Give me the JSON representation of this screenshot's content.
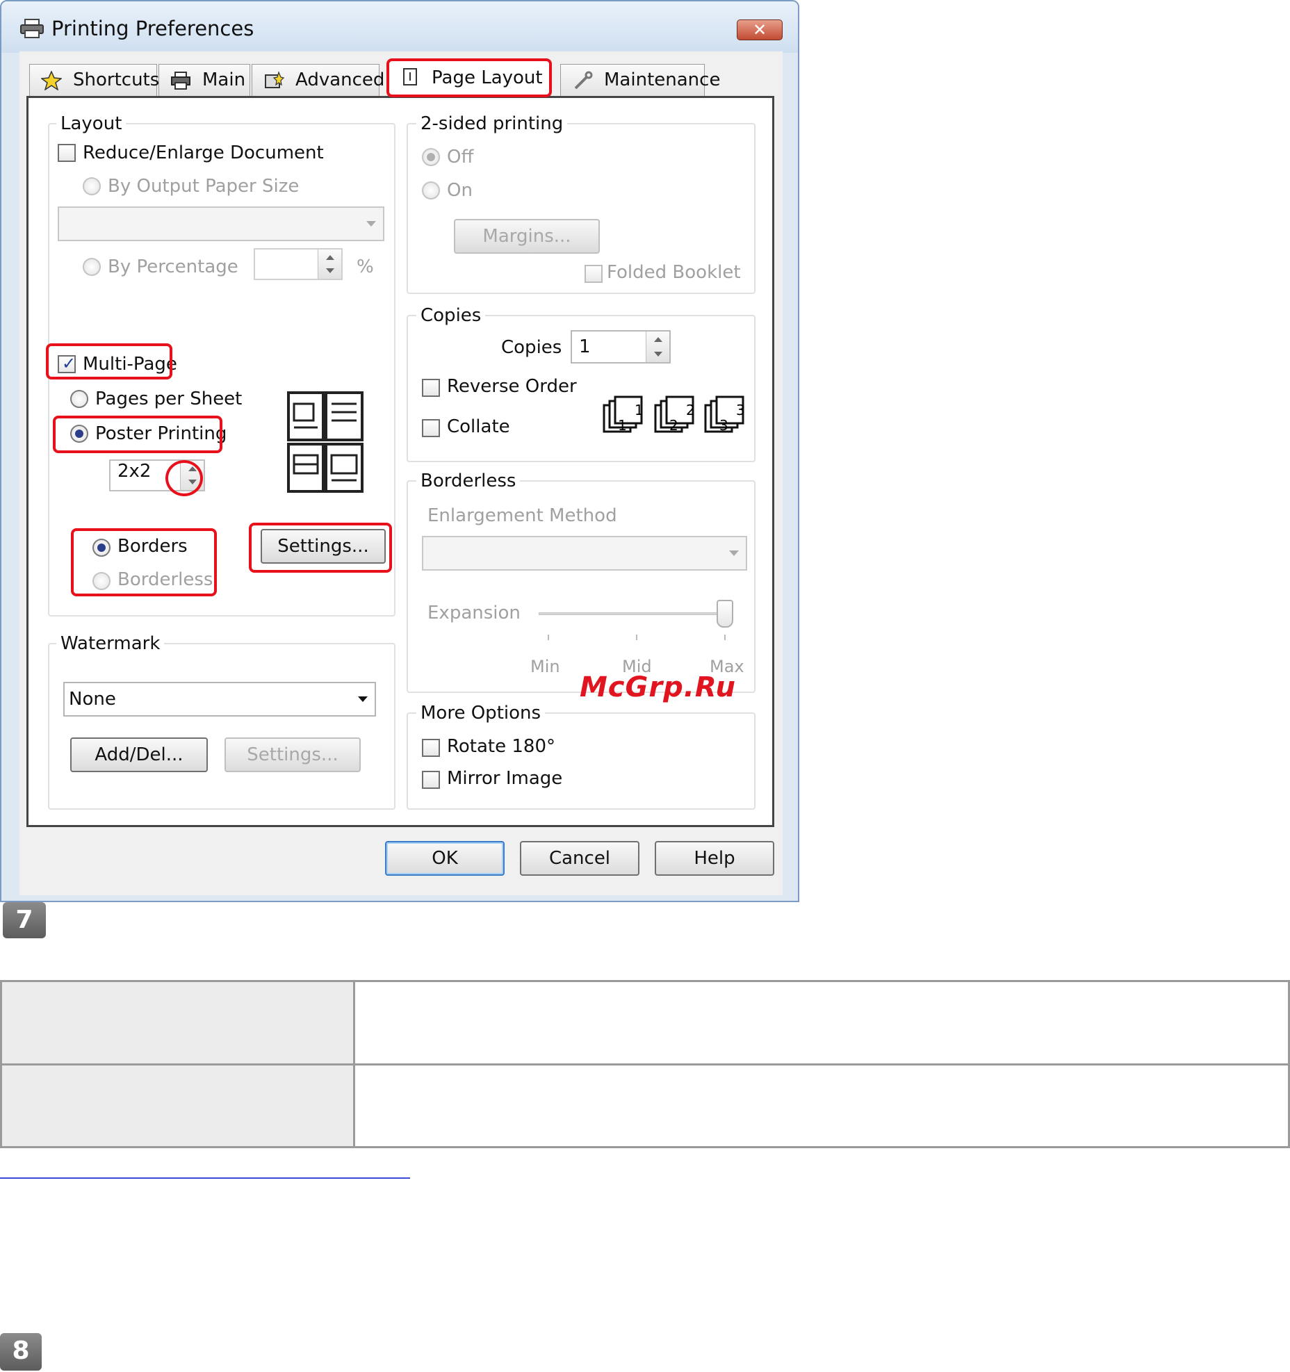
{
  "window": {
    "title": "Printing Preferences",
    "close_label": "✕"
  },
  "tabs": [
    {
      "label": "Shortcuts",
      "icon": "star-icon"
    },
    {
      "label": "Main",
      "icon": "printer-icon"
    },
    {
      "label": "Advanced",
      "icon": "advanced-gear-icon"
    },
    {
      "label": "Page Layout",
      "icon": "page-icon",
      "active": true
    },
    {
      "label": "Maintenance",
      "icon": "wrench-icon"
    }
  ],
  "layout": {
    "group_label": "Layout",
    "reduce_enlarge": {
      "label": "Reduce/Enlarge Document",
      "checked": false
    },
    "by_output_paper_size": "By Output Paper Size",
    "output_paper_value": "",
    "by_percentage": "By Percentage",
    "percentage_value": "",
    "percent_sign": "%",
    "multi_page": {
      "label": "Multi-Page",
      "checked": true
    },
    "pages_per_sheet": "Pages per Sheet",
    "poster_printing": "Poster Printing",
    "poster_value": "2x2",
    "borders": "Borders",
    "borderless": "Borderless",
    "settings_button": "Settings..."
  },
  "watermark": {
    "group_label": "Watermark",
    "selected": "None",
    "add_del_button": "Add/Del...",
    "settings_button": "Settings..."
  },
  "two_sided": {
    "group_label": "2-sided printing",
    "off": "Off",
    "on": "On",
    "margins_button": "Margins...",
    "folded_booklet": "Folded Booklet"
  },
  "copies": {
    "group_label": "Copies",
    "copies_label": "Copies",
    "copies_value": "1",
    "reverse_order": "Reverse Order",
    "collate": "Collate",
    "collate_sequence": [
      "1",
      "2",
      "3"
    ]
  },
  "borderless": {
    "group_label": "Borderless",
    "enlargement_method": "Enlargement Method",
    "enlargement_value": "",
    "expansion": "Expansion",
    "expansion_level": "Max",
    "scale_labels": [
      "Min",
      "Mid",
      "Max"
    ]
  },
  "more_options": {
    "group_label": "More Options",
    "rotate": "Rotate 180°",
    "mirror": "Mirror Image"
  },
  "footer": {
    "ok": "OK",
    "cancel": "Cancel",
    "help": "Help"
  },
  "overlay_watermark": "McGrp.Ru",
  "steps": [
    "7",
    "8"
  ],
  "colors": {
    "highlight": "#e8101a",
    "title_bar": "#cfdff0",
    "link": "#3a49d6"
  }
}
